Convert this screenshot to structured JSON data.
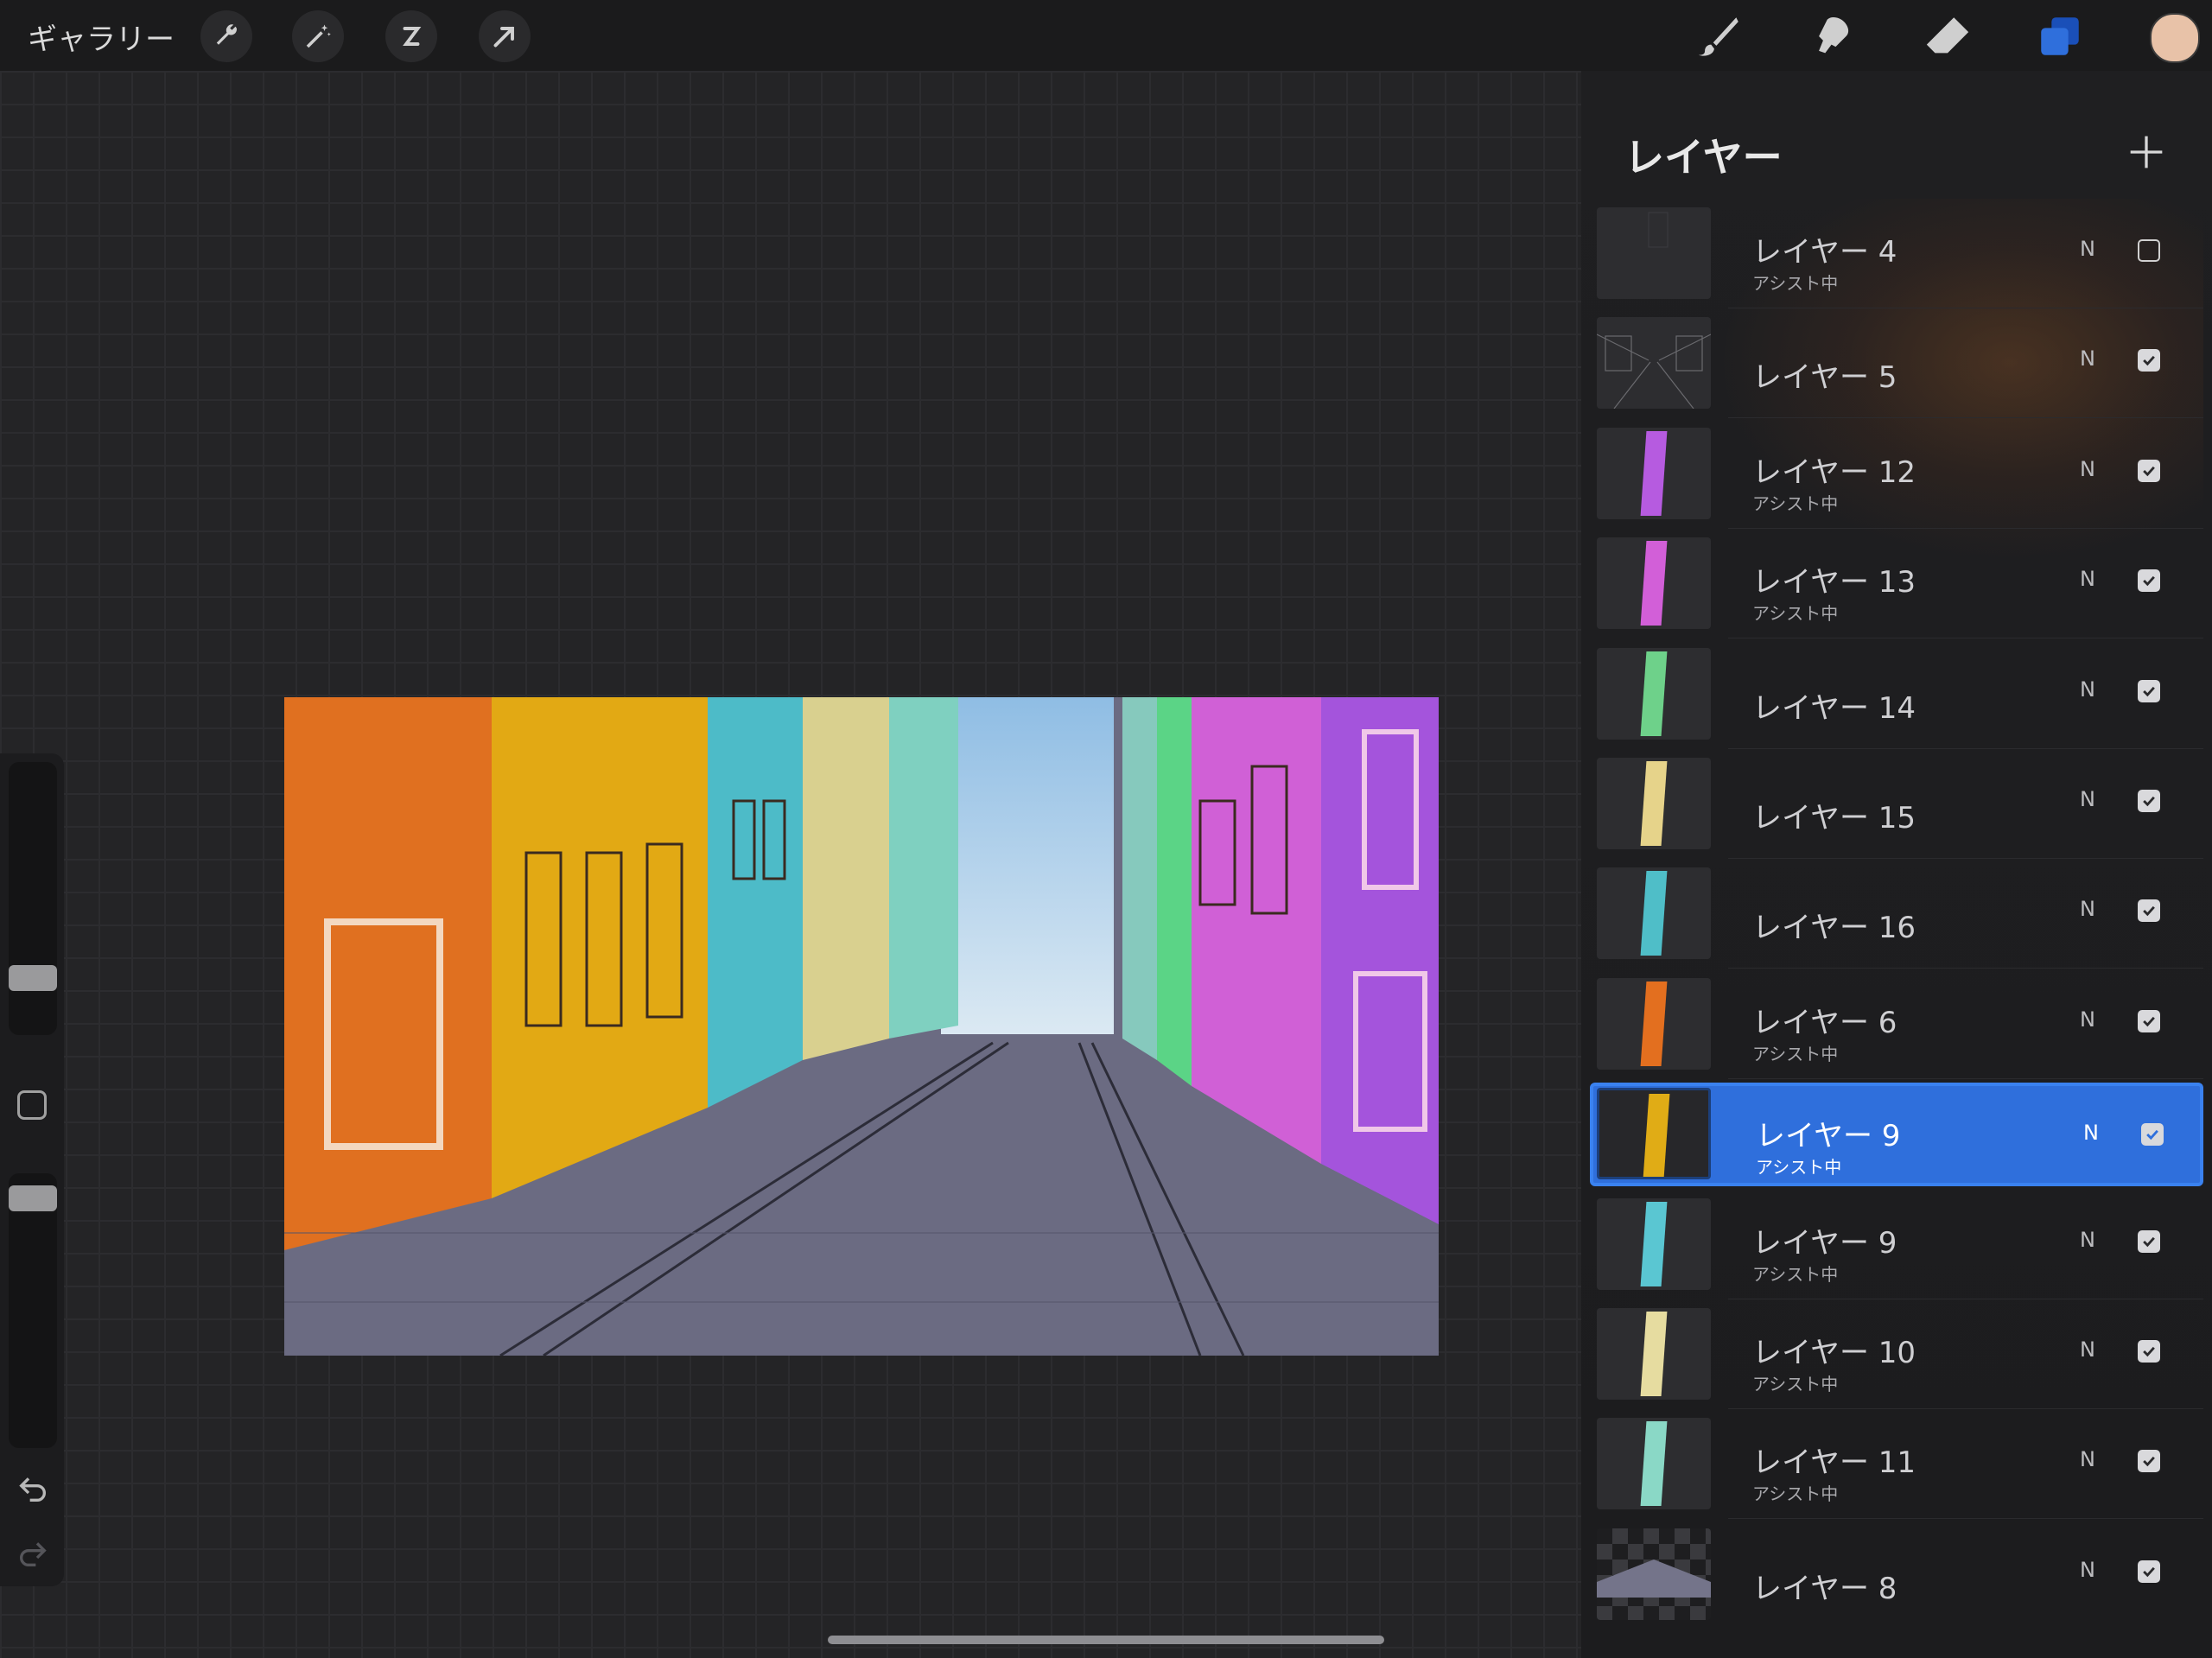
{
  "topbar": {
    "gallery_label": "ギャラリー",
    "tools_left": [
      "wrench-icon",
      "magic-wand-icon",
      "selection-icon",
      "transform-arrow-icon"
    ],
    "tools_right": [
      "brush-icon",
      "smudge-icon",
      "eraser-icon",
      "layers-icon"
    ],
    "current_color": "#e8c2a8",
    "active_tool_color": "#2f6fdc"
  },
  "panel": {
    "title": "レイヤー",
    "add_label": "+",
    "layers": [
      {
        "name": "レイヤー 4",
        "sub": "アシスト中",
        "blend": "N",
        "visible": false,
        "selected": false,
        "thumb": "faint"
      },
      {
        "name": "レイヤー 5",
        "sub": "",
        "blend": "N",
        "visible": true,
        "selected": false,
        "thumb": "sketch"
      },
      {
        "name": "レイヤー 12",
        "sub": "アシスト中",
        "blend": "N",
        "visible": true,
        "selected": false,
        "thumb": "#b65be0"
      },
      {
        "name": "レイヤー 13",
        "sub": "アシスト中",
        "blend": "N",
        "visible": true,
        "selected": false,
        "thumb": "#d25fd8"
      },
      {
        "name": "レイヤー 14",
        "sub": "",
        "blend": "N",
        "visible": true,
        "selected": false,
        "thumb": "#6ed18a"
      },
      {
        "name": "レイヤー 15",
        "sub": "",
        "blend": "N",
        "visible": true,
        "selected": false,
        "thumb": "#e6d38a"
      },
      {
        "name": "レイヤー 16",
        "sub": "",
        "blend": "N",
        "visible": true,
        "selected": false,
        "thumb": "#4fbec8"
      },
      {
        "name": "レイヤー 6",
        "sub": "アシスト中",
        "blend": "N",
        "visible": true,
        "selected": false,
        "thumb": "#e36f1f"
      },
      {
        "name": "レイヤー 9",
        "sub": "アシスト中",
        "blend": "N",
        "visible": true,
        "selected": true,
        "thumb": "#e0ac16"
      },
      {
        "name": "レイヤー 9",
        "sub": "アシスト中",
        "blend": "N",
        "visible": true,
        "selected": false,
        "thumb": "#5ac6d2"
      },
      {
        "name": "レイヤー 10",
        "sub": "アシスト中",
        "blend": "N",
        "visible": true,
        "selected": false,
        "thumb": "#e6dca0"
      },
      {
        "name": "レイヤー 11",
        "sub": "アシスト中",
        "blend": "N",
        "visible": true,
        "selected": false,
        "thumb": "#8ad8c6"
      },
      {
        "name": "レイヤー 8",
        "sub": "",
        "blend": "N",
        "visible": true,
        "selected": false,
        "thumb": "checker"
      }
    ]
  },
  "sidebar": {
    "brush_size_level": 0.18,
    "opacity_level": 0.95
  },
  "artwork": {
    "buildings": [
      {
        "color": "#e07020"
      },
      {
        "color": "#e2a914"
      },
      {
        "color": "#4dbbc8"
      },
      {
        "color": "#d9d08f"
      },
      {
        "color": "#7fd0c0"
      },
      {
        "color": "#5bd486"
      },
      {
        "color": "#d060d6"
      },
      {
        "color": "#a454dc"
      }
    ],
    "sky": "#9cc6e6",
    "road": "#6b6b82"
  }
}
